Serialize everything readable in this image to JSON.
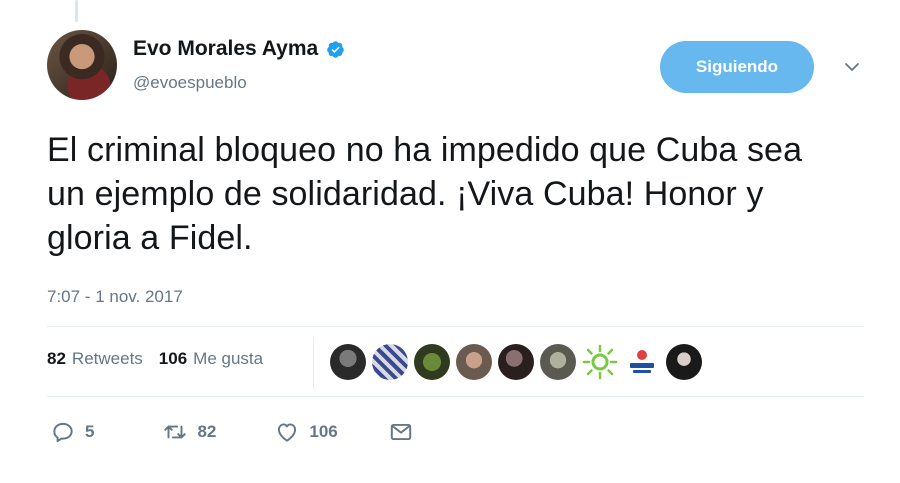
{
  "author": {
    "name": "Evo Morales Ayma",
    "handle": "@evoespueblo"
  },
  "follow_button": {
    "label": "Siguiendo"
  },
  "tweet": {
    "text": "El criminal bloqueo no ha impedido que Cuba sea un ejemplo de solidaridad. ¡Viva Cuba! Honor y gloria a Fidel.",
    "timestamp": "7:07 - 1 nov. 2017"
  },
  "stats": {
    "retweets_count": "82",
    "retweets_label": "Retweets",
    "likes_count": "106",
    "likes_label": "Me gusta"
  },
  "actions": {
    "reply_count": "5",
    "retweet_count": "82",
    "like_count": "106"
  },
  "icons": [
    "verified-badge-icon",
    "chevron-down-icon",
    "reply-icon",
    "retweet-icon",
    "heart-icon",
    "message-icon"
  ],
  "colors": {
    "accent": "#1da1f2",
    "follow_button_bg": "#66b8ef",
    "muted_text": "#657786",
    "text": "#14171a"
  }
}
